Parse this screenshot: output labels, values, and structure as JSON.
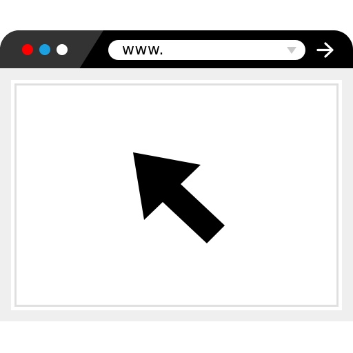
{
  "browser": {
    "address_bar": {
      "text": "www."
    },
    "window_controls": [
      {
        "name": "close",
        "color": "#ff0000"
      },
      {
        "name": "minimize",
        "color": "#1ba1e2"
      },
      {
        "name": "maximize",
        "color": "#ffffff"
      }
    ],
    "icons": {
      "dropdown": "chevron-down-icon",
      "go": "arrow-right-icon",
      "cursor": "mouse-pointer-icon"
    }
  },
  "colors": {
    "titlebar": "#000000",
    "titlebar_left": "#333333",
    "window_body": "#efefef",
    "viewport_border": "#e0e0e0",
    "dropdown_icon": "#c8c8c8",
    "cursor": "#000000"
  }
}
